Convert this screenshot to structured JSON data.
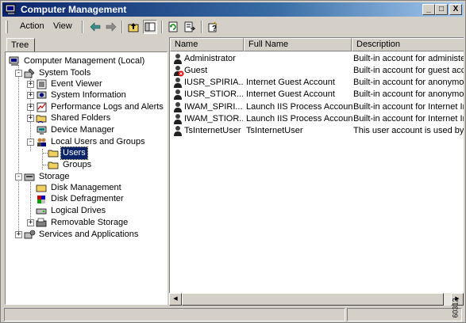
{
  "window": {
    "title": "Computer Management"
  },
  "title_buttons": {
    "minimize": "_",
    "maximize": "□",
    "close": "X"
  },
  "menu": {
    "action": "Action",
    "view": "View"
  },
  "toolbar_icons": [
    "back-arrow-icon",
    "forward-arrow-icon",
    "up-folder-icon",
    "show-hide-tree-icon",
    "refresh-icon",
    "export-list-icon",
    "help-icon"
  ],
  "left_tab": "Tree",
  "tree": {
    "root": "Computer Management (Local)",
    "system_tools": "System Tools",
    "event_viewer": "Event Viewer",
    "system_information": "System Information",
    "perf_logs": "Performance Logs and Alerts",
    "shared_folders": "Shared Folders",
    "device_manager": "Device Manager",
    "local_users_groups": "Local Users and Groups",
    "users": "Users",
    "groups": "Groups",
    "storage": "Storage",
    "disk_management": "Disk Management",
    "disk_defragmenter": "Disk Defragmenter",
    "logical_drives": "Logical Drives",
    "removable_storage": "Removable Storage",
    "services_apps": "Services and Applications"
  },
  "columns": {
    "name": "Name",
    "full_name": "Full Name",
    "description": "Description"
  },
  "users": [
    {
      "name": "Administrator",
      "full_name": "",
      "description": "Built-in account for administering"
    },
    {
      "name": "Guest",
      "full_name": "",
      "description": "Built-in account for guest access"
    },
    {
      "name": "IUSR_SPIRIA...",
      "full_name": "Internet Guest Account",
      "description": "Built-in account for anonymous"
    },
    {
      "name": "IUSR_STIOR...",
      "full_name": "Internet Guest Account",
      "description": "Built-in account for anonymous"
    },
    {
      "name": "IWAM_SPIRI...",
      "full_name": "Launch IIS Process Account",
      "description": "Built-in account for Internet In"
    },
    {
      "name": "IWAM_STIOR...",
      "full_name": "Launch IIS Process Account",
      "description": "Built-in account for Internet In"
    },
    {
      "name": "TsInternetUser",
      "full_name": "TsInternetUser",
      "description": "This user account is used by Te"
    }
  ],
  "figure_id": "60312",
  "colors": {
    "title_start": "#0a246a",
    "title_end": "#a6caf0",
    "selection": "#0a246a",
    "face": "#d4d0c8"
  }
}
